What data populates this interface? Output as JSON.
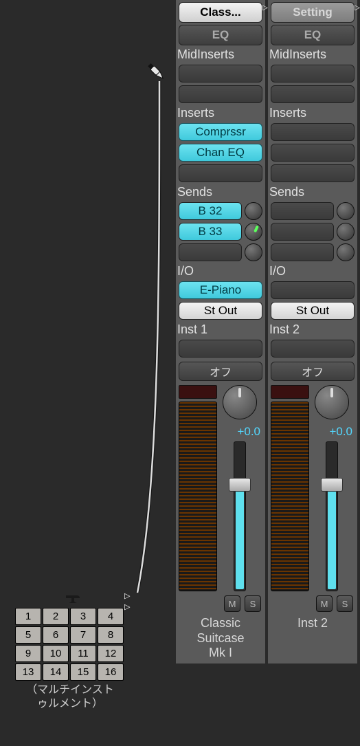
{
  "multi": {
    "cells": [
      "1",
      "2",
      "3",
      "4",
      "5",
      "6",
      "7",
      "8",
      "9",
      "10",
      "11",
      "12",
      "13",
      "14",
      "15",
      "16"
    ],
    "label_line1": "（マルチインスト",
    "label_line2": "ゥルメント）"
  },
  "strips": [
    {
      "setting": "Class...",
      "eq": "EQ",
      "midinserts_label": "MidInserts",
      "inserts_label": "Inserts",
      "inserts": [
        "Comprssr",
        "Chan EQ"
      ],
      "sends_label": "Sends",
      "sends": [
        "B 32",
        "B 33"
      ],
      "io_label": "I/O",
      "input": "E-Piano",
      "output": "St Out",
      "track_label": "Inst 1",
      "automation": "オフ",
      "fader_value": "+0.0",
      "mute": "M",
      "solo": "S",
      "name_l1": "Classic",
      "name_l2": "Suitcase",
      "name_l3": "Mk I"
    },
    {
      "setting": "Setting",
      "eq": "EQ",
      "midinserts_label": "MidInserts",
      "inserts_label": "Inserts",
      "inserts": [],
      "sends_label": "Sends",
      "sends": [],
      "io_label": "I/O",
      "input": "",
      "output": "St Out",
      "track_label": "Inst 2",
      "automation": "オフ",
      "fader_value": "+0.0",
      "mute": "M",
      "solo": "S",
      "name_l1": "Inst 2",
      "name_l2": "",
      "name_l3": ""
    }
  ]
}
